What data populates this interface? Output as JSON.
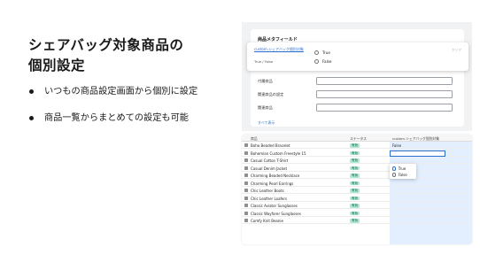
{
  "slide": {
    "title_line1": "シェアバッグ対象商品の",
    "title_line2": "個別設定",
    "bullets": [
      "いつもの商品設定画面から個別に設定",
      "商品一覧からまとめての設定も可能"
    ]
  },
  "product_edit": {
    "section_title": "商品メタフィールド",
    "popover": {
      "field_name": "custom.シェアバッグ個別対象",
      "field_sub": "True / False",
      "hint": "クリア",
      "options": [
        "True",
        "False"
      ]
    },
    "fields": [
      "付属商品",
      "関連商品の設定",
      "関連商品"
    ],
    "show_all": "すべて表示"
  },
  "bulk_editor": {
    "columns": [
      "商品",
      "ステータス",
      "custom.シェアバッグ個別対象"
    ],
    "first_value": "False",
    "status_label": "有効",
    "dropdown_options": [
      "True",
      "False"
    ],
    "products": [
      "Boho Beaded Bracelet",
      "Bohemian Custom Freestyle 15",
      "Casual Cotton T-Shirt",
      "Casual Denim Jacket",
      "Charming Beaded Necklace",
      "Charming Pearl Earrings",
      "Chic Leather Boots",
      "Chic Leather Loafers",
      "Classic Aviator Sunglasses",
      "Classic Wayfarer Sunglasses",
      "Comfy Knit Beanie"
    ]
  },
  "colors": {
    "accent": "#2c6ecb",
    "badge_bg": "#aee9d1",
    "selected_column": "#e3efff"
  }
}
